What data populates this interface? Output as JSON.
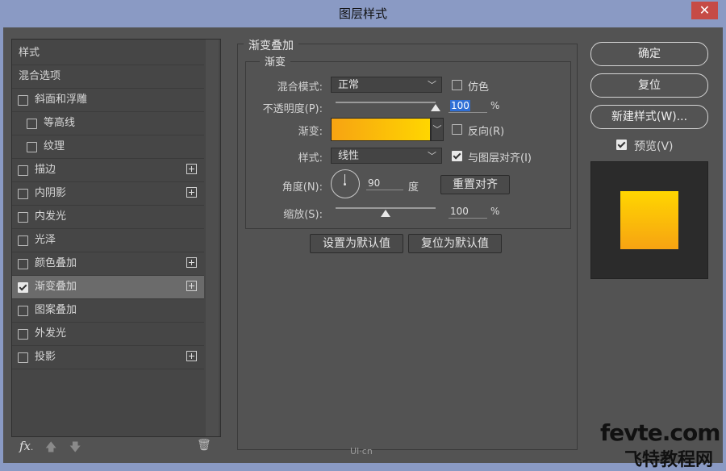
{
  "window": {
    "title": "图层样式",
    "close_glyph": "✕"
  },
  "left_panel": {
    "items": [
      {
        "label": "样式",
        "checkbox": false,
        "checked": false,
        "plus": false,
        "selected": false
      },
      {
        "label": "混合选项",
        "checkbox": false,
        "checked": false,
        "plus": false,
        "selected": false
      },
      {
        "label": "斜面和浮雕",
        "checkbox": true,
        "checked": false,
        "plus": false,
        "selected": false
      },
      {
        "label": "等高线",
        "checkbox": true,
        "checked": false,
        "plus": false,
        "selected": false,
        "indent": true
      },
      {
        "label": "纹理",
        "checkbox": true,
        "checked": false,
        "plus": false,
        "selected": false,
        "indent": true
      },
      {
        "label": "描边",
        "checkbox": true,
        "checked": false,
        "plus": true,
        "selected": false
      },
      {
        "label": "内阴影",
        "checkbox": true,
        "checked": false,
        "plus": true,
        "selected": false
      },
      {
        "label": "内发光",
        "checkbox": true,
        "checked": false,
        "plus": false,
        "selected": false
      },
      {
        "label": "光泽",
        "checkbox": true,
        "checked": false,
        "plus": false,
        "selected": false
      },
      {
        "label": "颜色叠加",
        "checkbox": true,
        "checked": false,
        "plus": true,
        "selected": false
      },
      {
        "label": "渐变叠加",
        "checkbox": true,
        "checked": true,
        "plus": true,
        "selected": true
      },
      {
        "label": "图案叠加",
        "checkbox": true,
        "checked": false,
        "plus": false,
        "selected": false
      },
      {
        "label": "外发光",
        "checkbox": true,
        "checked": false,
        "plus": false,
        "selected": false
      },
      {
        "label": "投影",
        "checkbox": true,
        "checked": false,
        "plus": true,
        "selected": false
      }
    ],
    "footer": {
      "fx_label": "fx",
      "fx_suffix": ".",
      "up_glyph": "🡅",
      "down_glyph": "🡇",
      "trash_glyph": "🗑"
    }
  },
  "gradient_overlay": {
    "group_title": "渐变叠加",
    "subgroup_title": "渐变",
    "blend_mode": {
      "label": "混合模式:",
      "value": "正常"
    },
    "dither": {
      "label": "仿色",
      "checked": false
    },
    "opacity": {
      "label": "不透明度(P):",
      "value": "100",
      "unit": "%",
      "level": 1.0
    },
    "gradient": {
      "label": "渐变:",
      "start_color": "#f7a312",
      "end_color": "#ffd600"
    },
    "reverse": {
      "label": "反向(R)",
      "checked": false
    },
    "style": {
      "label": "样式:",
      "value": "线性"
    },
    "align_with_layer": {
      "label": "与图层对齐(I)",
      "checked": true
    },
    "angle": {
      "label": "角度(N):",
      "value": "90",
      "unit": "度"
    },
    "reset_alignment": "重置对齐",
    "scale": {
      "label": "缩放(S):",
      "value": "100",
      "unit": "%",
      "level": 0.5
    },
    "make_default": "设置为默认值",
    "reset_default": "复位为默认值"
  },
  "right_panel": {
    "ok": "确定",
    "reset": "复位",
    "new_style": "新建样式(W)...",
    "preview": {
      "label": "预览(V)",
      "checked": true
    },
    "swatch_colors": [
      "#ffd600",
      "#f7a312"
    ]
  },
  "watermark": {
    "line1": "fevte.com",
    "line2": "飞特教程网",
    "center": "UI·cn"
  }
}
